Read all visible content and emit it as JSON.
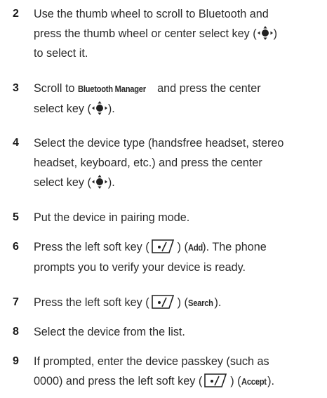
{
  "steps": [
    {
      "num": "2",
      "l1": "Use the thumb wheel to scroll to Bluetooth and",
      "l2a": "press the thumb wheel or center select key (",
      "l2b": ")",
      "l3": "to select it."
    },
    {
      "num": "3",
      "l1a": "Scroll to ",
      "l1ui": "Bluetooth Manager",
      "l1b": " and press the center",
      "l2a": "select key (",
      "l2b": ")."
    },
    {
      "num": "4",
      "l1": "Select the device type (handsfree headset, stereo",
      "l2": "headset, keyboard, etc.) and press the center",
      "l3a": "select key (",
      "l3b": ")."
    },
    {
      "num": "5",
      "l1": "Put the device in pairing mode."
    },
    {
      "num": "6",
      "l1a": "Press the left soft key (",
      "l1b": ") (",
      "l1ui": "Add",
      "l1c": "). The phone",
      "l2": "prompts you to verify your device is ready."
    },
    {
      "num": "7",
      "l1a": "Press the left soft key (",
      "l1b": ") (",
      "l1ui": "Search",
      "l1c": ")."
    },
    {
      "num": "8",
      "l1": "Select the device from the list."
    },
    {
      "num": "9",
      "l1": "If prompted, enter the device passkey (such as",
      "l2a": "0000) and press the left soft key (",
      "l2b": ") (",
      "l2ui": "Accept",
      "l2c": ")."
    }
  ],
  "icons": {
    "center_select_key": "center-select-key-icon",
    "left_soft_key": "left-soft-key-icon"
  }
}
